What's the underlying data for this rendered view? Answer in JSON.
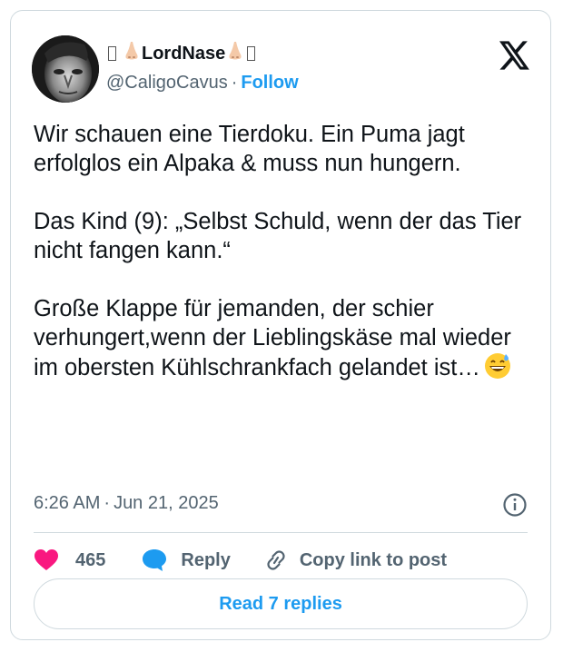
{
  "author": {
    "display_name": "LordNase",
    "handle": "@CaligoCavus",
    "follow_label": "Follow",
    "avatar_icon": "avatar-grayscale-face"
  },
  "separator": "·",
  "tweet": {
    "paragraphs": [
      "Wir schauen eine Tierdoku. Ein Puma jagt erfolglos ein Alpaka & muss nun hungern.",
      "Das Kind (9): „Selbst Schuld, wenn der das Tier nicht fangen kann.“",
      "Große Klappe für jemanden, der schier verhungert,wenn der Lieblingskäse mal wieder im obersten Kühlschrankfach gelandet ist…"
    ],
    "trailing_emoji": "grinning-sweat-emoji",
    "time": "6:26 AM",
    "date": "Jun 21, 2025"
  },
  "actions": {
    "like_count": "465",
    "reply_label": "Reply",
    "copy_label": "Copy link to post"
  },
  "read_replies_label": "Read 7 replies",
  "colors": {
    "accent": "#1d9bf0",
    "like": "#f91880",
    "text": "#0f1419",
    "muted": "#536471",
    "border": "#cfd9de"
  }
}
